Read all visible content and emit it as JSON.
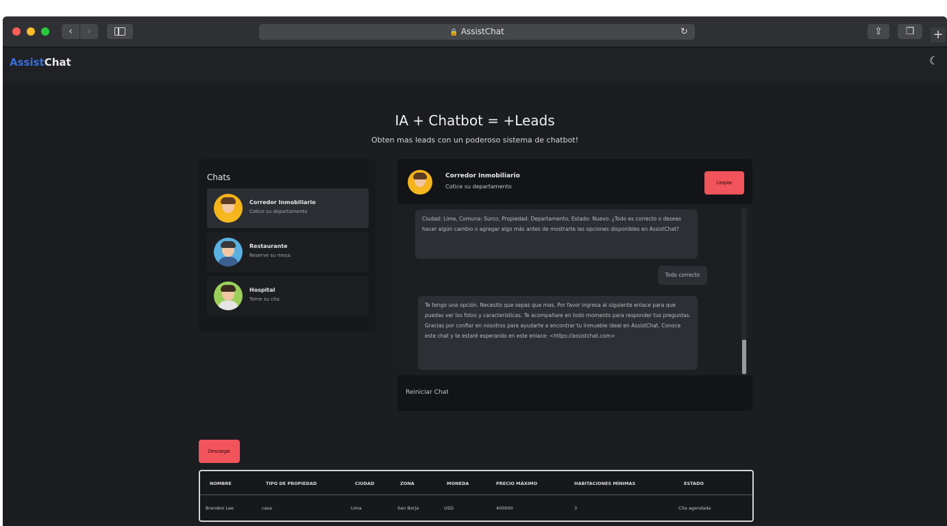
{
  "browser": {
    "url_display": "AssistChat",
    "lock_glyph": "🔒",
    "back_glyph": "‹",
    "forward_glyph": "›",
    "reload_glyph": "↻",
    "share_glyph": "⇪",
    "tabs_glyph": "❐",
    "newtab_glyph": "+"
  },
  "appbar": {
    "logo_part1": "Assist",
    "logo_part2": "Chat",
    "theme_icon": "☾"
  },
  "hero": {
    "title": "IA + Chatbot = +Leads",
    "subtitle": "Obten mas leads con un poderoso sistema de chatbot!"
  },
  "chats": {
    "title": "Chats",
    "items": [
      {
        "name": "Corredor Inmobiliario",
        "subtitle": "Cotice su departamento",
        "hair": "#5a3a25",
        "body": "#f6b81f",
        "bg": "#f4b41a"
      },
      {
        "name": "Restaurante",
        "subtitle": "Reserve su mesa",
        "hair": "#3a3a3a",
        "body": "#3d5f8f",
        "bg": "#5ab0e0"
      },
      {
        "name": "Hospital",
        "subtitle": "Tome su cita",
        "hair": "#3b2a1e",
        "body": "#e5e5e5",
        "bg": "#9bcf5a"
      }
    ]
  },
  "chat": {
    "header_name": "Corredor Inmobiliario",
    "header_sub": "Cotice su departamento",
    "clear_button": "Limpiar",
    "messages": [
      {
        "from": "bot",
        "text": "Ciudad: Lima, Comuna: Surco, Propiedad: Departamento, Estado: Nuevo. ¿Todo es correcto o deseas hacer algún cambio o agregar algo más antes de mostrarte las opciones disponibles en AssistChat?"
      },
      {
        "from": "user",
        "text": "Todo correcto"
      },
      {
        "from": "bot",
        "text": "Te tengo una opción. Necesito que sepas que mas. Por favor ingresa al siguiente enlace para que puedas ver los fotos y caracteristicas. Te acompañare en todo momento para responder tus preguntas. Gracias por confiar en nosotros para ayudarte a encontrar tu inmueble ideal en AssistChat. Conoce este chat y te estaré esperando en este enlace: <https://assistchat.com>"
      }
    ],
    "footer_label": "Reiniciar Chat"
  },
  "leads": {
    "button": "Descargar",
    "columns": [
      "NOMBRE",
      "TIPO DE PROPIEDAD",
      "CIUDAD",
      "ZONA",
      "MONEDA",
      "PRECIO MÁXIMO",
      "HABITACIONES MÍNIMAS",
      "ESTADO"
    ],
    "rows": [
      [
        "Brandon Lee",
        "casa",
        "Lima",
        "San Borja",
        "USD",
        "400000",
        "3",
        "Cita agendada"
      ]
    ]
  }
}
